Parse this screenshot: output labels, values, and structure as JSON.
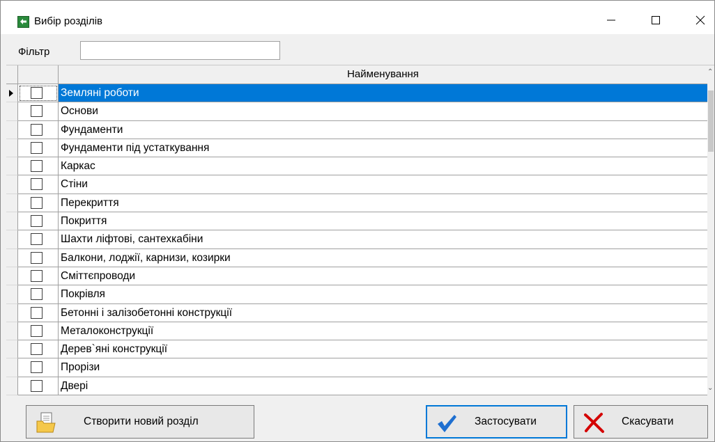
{
  "window": {
    "title": "Вибір розділів",
    "icons": [
      "app-icon",
      "minimize-icon",
      "maximize-icon",
      "close-icon"
    ]
  },
  "filter": {
    "label": "Фільтр",
    "value": "",
    "clear_icon": "broom-icon"
  },
  "grid": {
    "column_header": "Найменування",
    "rows": [
      {
        "name": "Земляні роботи",
        "checked": false,
        "selected": true
      },
      {
        "name": "Основи",
        "checked": false
      },
      {
        "name": "Фундаменти",
        "checked": false
      },
      {
        "name": "Фундаменти під устаткування",
        "checked": false
      },
      {
        "name": "Каркас",
        "checked": false
      },
      {
        "name": "Стіни",
        "checked": false
      },
      {
        "name": "Перекриття",
        "checked": false
      },
      {
        "name": "Покриття",
        "checked": false
      },
      {
        "name": "Шахти ліфтові, сантехкабіни",
        "checked": false
      },
      {
        "name": "Балкони, лоджії, карнизи, козирки",
        "checked": false
      },
      {
        "name": "Сміттєпроводи",
        "checked": false
      },
      {
        "name": "Покрівля",
        "checked": false
      },
      {
        "name": "Бетонні і залізобетонні конструкції",
        "checked": false
      },
      {
        "name": "Металоконструкції",
        "checked": false
      },
      {
        "name": "Дерев`яні конструкції",
        "checked": false
      },
      {
        "name": "Прорізи",
        "checked": false
      },
      {
        "name": "Двері",
        "checked": false
      }
    ]
  },
  "buttons": {
    "create_label": "Створити новий розділ",
    "apply_label": "Застосувати",
    "cancel_label": "Скасувати"
  },
  "colors": {
    "selection": "#0078d7",
    "apply_icon": "#1e6fd0",
    "cancel_icon": "#d40000"
  }
}
